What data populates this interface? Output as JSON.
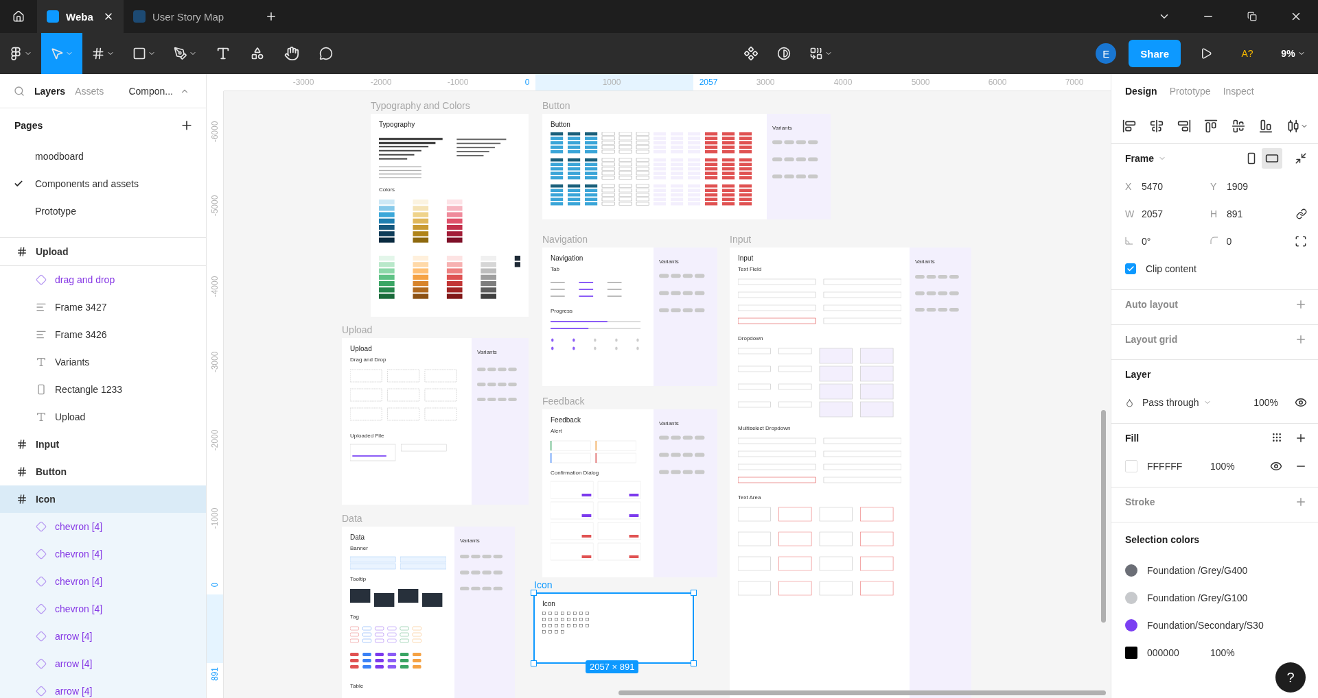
{
  "window": {
    "tabs": [
      {
        "label": "Weba",
        "selected": true
      },
      {
        "label": "User Story Map",
        "selected": false
      }
    ]
  },
  "toolbar": {
    "tools": [
      {
        "kind": "main-menu",
        "selected": false
      },
      {
        "kind": "move",
        "selected": true
      },
      {
        "kind": "frame",
        "selected": false
      },
      {
        "kind": "shape",
        "selected": false
      },
      {
        "kind": "pen",
        "selected": false
      },
      {
        "kind": "text",
        "selected": false
      },
      {
        "kind": "resources",
        "selected": false
      },
      {
        "kind": "hand",
        "selected": false
      },
      {
        "kind": "comment",
        "selected": false
      }
    ],
    "avatar": "E",
    "share": "Share",
    "font_warning": "A?",
    "zoom": "9%"
  },
  "layers_panel": {
    "tabs": [
      {
        "label": "Layers",
        "selected": true
      },
      {
        "label": "Assets",
        "selected": false
      }
    ],
    "page_selector": "Compon...",
    "pages": {
      "title": "Pages",
      "items": [
        {
          "label": "moodboard",
          "selected": false
        },
        {
          "label": "Components and assets",
          "selected": true
        },
        {
          "label": "Prototype",
          "selected": false
        }
      ]
    },
    "layers": [
      {
        "kind": "frame",
        "label": "Upload",
        "selected": false,
        "children": [
          {
            "kind": "component",
            "label": "drag and drop",
            "selected": false
          },
          {
            "kind": "autolayout",
            "label": "Frame 3427",
            "selected": false
          },
          {
            "kind": "autolayout",
            "label": "Frame 3426",
            "selected": false
          },
          {
            "kind": "text",
            "label": "Variants",
            "selected": false
          },
          {
            "kind": "rectangle",
            "label": "Rectangle 1233",
            "selected": false
          },
          {
            "kind": "text",
            "label": "Upload",
            "selected": false
          }
        ]
      },
      {
        "kind": "frame",
        "label": "Input",
        "selected": false
      },
      {
        "kind": "frame",
        "label": "Button",
        "selected": false
      },
      {
        "kind": "frame",
        "label": "Icon",
        "selected": true,
        "children": [
          {
            "kind": "component",
            "label": "chevron [4]",
            "selected": false
          },
          {
            "kind": "component",
            "label": "chevron [4]",
            "selected": false
          },
          {
            "kind": "component",
            "label": "chevron [4]",
            "selected": false
          },
          {
            "kind": "component",
            "label": "chevron [4]",
            "selected": false
          },
          {
            "kind": "component",
            "label": "arrow [4]",
            "selected": false
          },
          {
            "kind": "component",
            "label": "arrow [4]",
            "selected": false
          },
          {
            "kind": "component",
            "label": "arrow [4]",
            "selected": false
          }
        ]
      }
    ]
  },
  "rulers": {
    "horizontal": [
      {
        "label": "-3000",
        "kind": "tick"
      },
      {
        "label": "-2000",
        "kind": "tick"
      },
      {
        "label": "-1000",
        "kind": "tick"
      },
      {
        "label": "0",
        "kind": "selection"
      },
      {
        "label": "1000",
        "kind": "tick"
      },
      {
        "label": "2057",
        "kind": "selection"
      },
      {
        "label": "3000",
        "kind": "tick"
      },
      {
        "label": "4000",
        "kind": "tick"
      },
      {
        "label": "5000",
        "kind": "tick"
      },
      {
        "label": "6000",
        "kind": "tick"
      },
      {
        "label": "7000",
        "kind": "tick"
      }
    ],
    "vertical": [
      {
        "label": "-6000",
        "kind": "tick"
      },
      {
        "label": "-5000",
        "kind": "tick"
      },
      {
        "label": "-4000",
        "kind": "tick"
      },
      {
        "label": "-3000",
        "kind": "tick"
      },
      {
        "label": "-2000",
        "kind": "tick"
      },
      {
        "label": "-1000",
        "kind": "tick"
      },
      {
        "label": "0",
        "kind": "selection"
      },
      {
        "label": "891",
        "kind": "selection"
      }
    ]
  },
  "canvas": {
    "frames": [
      {
        "label": "Typography and Colors",
        "title": "Typography",
        "selected": false,
        "has_variants": false,
        "sections": [
          {
            "kind": "text"
          },
          {
            "title": "Colors",
            "kind": "swatches"
          }
        ]
      },
      {
        "label": "Button",
        "title": "Button",
        "selected": false,
        "has_variants": true,
        "variants": "Variants",
        "sections": [
          {
            "kind": "buttons"
          }
        ]
      },
      {
        "label": "Navigation",
        "title": "Navigation",
        "selected": false,
        "has_variants": true,
        "variants": "Variants",
        "sections": [
          {
            "title": "Tab",
            "kind": "tabs"
          },
          {
            "title": "Progress",
            "kind": "progress"
          }
        ]
      },
      {
        "label": "Input",
        "title": "Input",
        "selected": false,
        "has_variants": true,
        "variants": "Variants",
        "sections": [
          {
            "title": "Text Field",
            "kind": "fields"
          },
          {
            "title": "Dropdown",
            "kind": "dropdowns"
          },
          {
            "title": "Multiselect Dropdown",
            "kind": "fields"
          },
          {
            "title": "Text Area",
            "kind": "areas"
          }
        ]
      },
      {
        "label": "Upload",
        "title": "Upload",
        "selected": false,
        "has_variants": true,
        "variants": "Variants",
        "sections": [
          {
            "title": "Drag and Drop",
            "kind": "dropzones"
          },
          {
            "title": "Uploaded File",
            "kind": "files"
          }
        ]
      },
      {
        "label": "Feedback",
        "title": "Feedback",
        "selected": false,
        "has_variants": true,
        "variants": "Variants",
        "sections": [
          {
            "title": "Alert",
            "kind": "alerts"
          },
          {
            "title": "Confirmation Dialog",
            "kind": "dialogs"
          }
        ]
      },
      {
        "label": "Data",
        "title": "Data",
        "selected": false,
        "has_variants": true,
        "variants": "Variants",
        "sections": [
          {
            "title": "Banner",
            "kind": "banners"
          },
          {
            "title": "Tooltip",
            "kind": "tooltips"
          },
          {
            "title": "Tag",
            "kind": "tags"
          },
          {
            "title": "Table",
            "kind": "none"
          }
        ]
      },
      {
        "label": "Icon",
        "title": "Icon",
        "selected": true,
        "has_variants": false,
        "sections": [
          {
            "kind": "icons"
          }
        ]
      }
    ],
    "selection_size": "2057 × 891"
  },
  "design_panel": {
    "tabs": [
      {
        "label": "Design",
        "selected": true
      },
      {
        "label": "Prototype",
        "selected": false
      },
      {
        "label": "Inspect",
        "selected": false
      }
    ],
    "frame": {
      "title": "Frame",
      "landscape": true,
      "fields": [
        {
          "label": "X",
          "value": "5470"
        },
        {
          "label": "Y",
          "value": "1909"
        },
        {
          "label": "W",
          "value": "2057"
        },
        {
          "label": "H",
          "value": "891"
        }
      ],
      "rotation": "0°",
      "radius": "0",
      "clip_content": {
        "label": "Clip content",
        "checked": true
      }
    },
    "empty_sections": [
      {
        "title": "Auto layout"
      },
      {
        "title": "Layout grid"
      }
    ],
    "layer": {
      "title": "Layer",
      "blend": "Pass through",
      "opacity": "100%"
    },
    "fill": {
      "title": "Fill",
      "hex": "FFFFFF",
      "opacity": "100%",
      "color": "#ffffff"
    },
    "stroke": {
      "title": "Stroke"
    },
    "selection_colors": {
      "title": "Selection colors",
      "items": [
        {
          "label": "Foundation /Grey/G400",
          "color": "#6b6e76",
          "kind": "style"
        },
        {
          "label": "Foundation /Grey/G100",
          "color": "#c7c9cc",
          "kind": "style"
        },
        {
          "label": "Foundation/Secondary/S30",
          "color": "#7b3ff2",
          "kind": "style"
        },
        {
          "label": "000000",
          "opacity": "100%",
          "color": "#000000",
          "kind": "hex"
        }
      ]
    }
  },
  "help": "?"
}
